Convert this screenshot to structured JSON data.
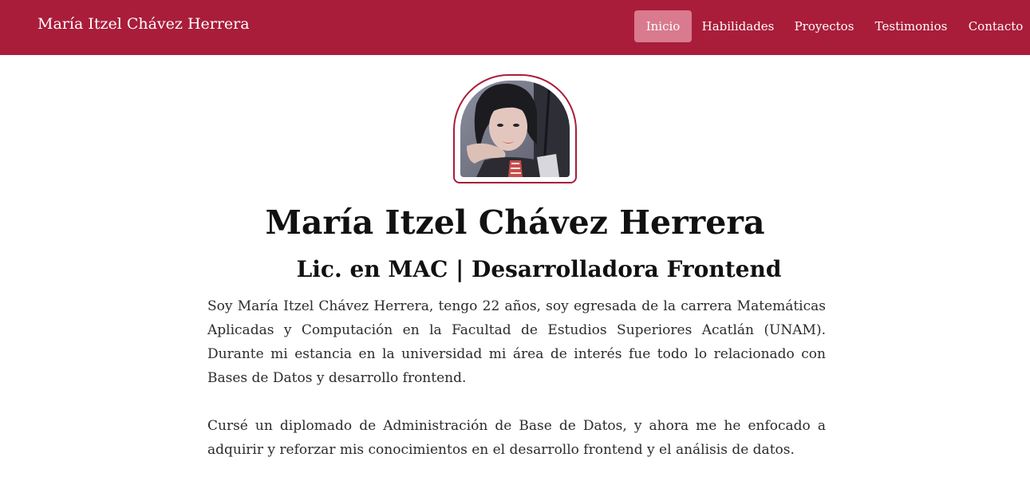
{
  "header": {
    "brand": "María Itzel Chávez Herrera",
    "nav": [
      {
        "label": "Inicio",
        "active": true
      },
      {
        "label": "Habilidades",
        "active": false
      },
      {
        "label": "Proyectos",
        "active": false
      },
      {
        "label": "Testimonios",
        "active": false
      },
      {
        "label": "Contacto",
        "active": false
      }
    ]
  },
  "hero": {
    "name": "María Itzel Chávez Herrera",
    "subtitle": "Lic. en MAC | Desarrolladora Frontend"
  },
  "about": {
    "p1": "Soy María Itzel Chávez Herrera, tengo 22 años, soy egresada de la carrera Matemáticas Aplicadas y Computación en la Facultad de Estudios Superiores Acatlán (UNAM). Durante mi estancia en la universidad mi área de interés fue todo lo relacionado con Bases de Datos y desarrollo frontend.",
    "p2": "Cursé un diplomado de Administración de Base de Datos, y ahora me he enfocado a adquirir y reforzar mis conocimientos en el desarrollo frontend y el análisis de datos."
  },
  "colors": {
    "primary": "#a91d3a",
    "active_nav": "#d97a8f"
  }
}
